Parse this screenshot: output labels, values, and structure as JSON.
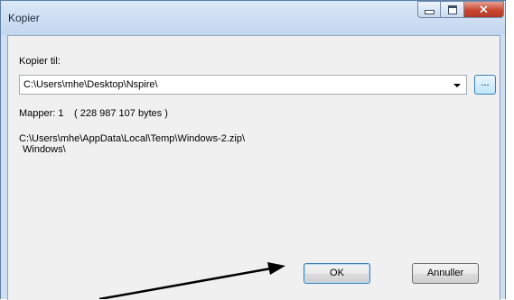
{
  "window": {
    "title": "Kopier"
  },
  "dest": {
    "label": "Kopier til:",
    "path": "C:\\Users\\mhe\\Desktop\\Nspire\\",
    "browse_label": "..."
  },
  "summary": {
    "folders": "Mapper: 1",
    "size": "( 228 987 107 bytes )"
  },
  "source": {
    "line1": "C:\\Users\\mhe\\AppData\\Local\\Temp\\Windows-2.zip\\",
    "line2": "Windows\\"
  },
  "buttons": {
    "ok": "OK",
    "cancel": "Annuller"
  },
  "colors": {
    "arrow": "#000000",
    "close": "#c9462f"
  }
}
